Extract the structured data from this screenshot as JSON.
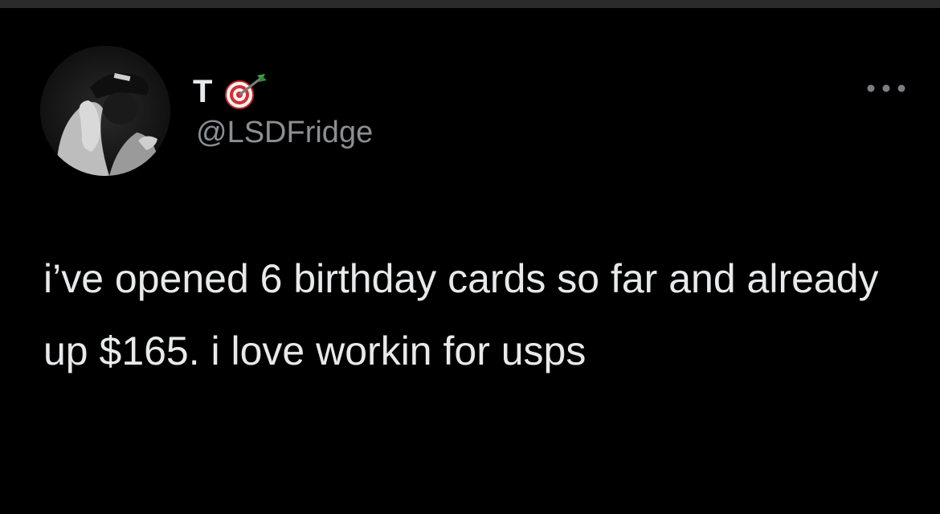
{
  "tweet": {
    "display_name": "T",
    "handle": "@LSDFridge",
    "text": "i’ve opened 6 birthday cards so far and already up $165. i love workin for usps",
    "name_emoji": "direct-hit-dart-icon",
    "more_icon": "more-options-icon"
  },
  "colors": {
    "background": "#000000",
    "primary_text": "#e7e9ea",
    "secondary_text": "#8b8f93"
  }
}
